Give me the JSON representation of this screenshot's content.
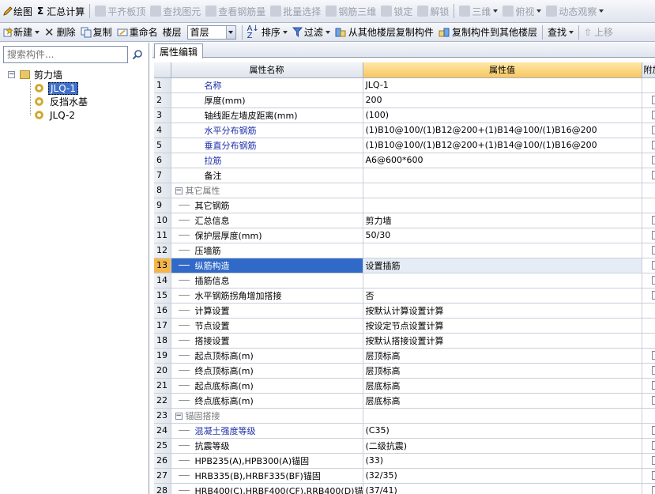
{
  "toolbar_main": {
    "draw": "绘图",
    "sum_calc": "汇总计算",
    "flush_slab": "平齐板顶",
    "find_element": "查找图元",
    "view_rebar": "查看钢筋量",
    "batch_select": "批量选择",
    "rebar_3d": "钢筋三维",
    "lock": "锁定",
    "unlock": "解锁",
    "three_d": "三维",
    "top_view": "俯视",
    "dynamic_view": "动态观察"
  },
  "toolbar_second": {
    "new": "新建",
    "delete": "删除",
    "copy": "复制",
    "rename": "重命名",
    "floor_label": "楼层",
    "floor_value": "首层",
    "sort": "排序",
    "filter": "过滤",
    "copy_from_floor": "从其他楼层复制构件",
    "copy_to_floor": "复制构件到其他楼层",
    "find": "查找",
    "up_move": "上移"
  },
  "left_panel": {
    "search_placeholder": "搜索构件...",
    "tree": {
      "root": "剪力墙",
      "children": [
        "JLQ-1",
        "反挡水基",
        "JLQ-2"
      ]
    }
  },
  "right_panel": {
    "tab": "属性编辑",
    "headers": {
      "name": "属性名称",
      "value": "属性值",
      "extra": "附加"
    },
    "rows": [
      {
        "n": "1",
        "name": "名称",
        "value": "JLQ-1",
        "style": "blue",
        "chk": false
      },
      {
        "n": "2",
        "name": "厚度(mm)",
        "value": "200",
        "style": "normal",
        "chk": true
      },
      {
        "n": "3",
        "name": "轴线距左墙皮距离(mm)",
        "value": "(100)",
        "style": "normal",
        "chk": true
      },
      {
        "n": "4",
        "name": "水平分布钢筋",
        "value": "(1)B10@100/(1)B12@200+(1)B14@100/(1)B16@200",
        "style": "blue",
        "chk": true
      },
      {
        "n": "5",
        "name": "垂直分布钢筋",
        "value": "(1)B10@100/(1)B12@200+(1)B14@100/(1)B16@200",
        "style": "blue",
        "chk": true
      },
      {
        "n": "6",
        "name": "拉筋",
        "value": "A6@600*600",
        "style": "blue",
        "chk": true
      },
      {
        "n": "7",
        "name": "备注",
        "value": "",
        "style": "normal",
        "chk": true
      },
      {
        "n": "8",
        "name": "其它属性",
        "value": "",
        "style": "group",
        "chk": false
      },
      {
        "n": "9",
        "name": "其它钢筋",
        "value": "",
        "style": "child",
        "chk": false
      },
      {
        "n": "10",
        "name": "汇总信息",
        "value": "剪力墙",
        "style": "child",
        "chk": true
      },
      {
        "n": "11",
        "name": "保护层厚度(mm)",
        "value": "50/30",
        "style": "child",
        "chk": true
      },
      {
        "n": "12",
        "name": "压墙筋",
        "value": "",
        "style": "child",
        "chk": true
      },
      {
        "n": "13",
        "name": "纵筋构造",
        "value": "设置插筋",
        "style": "child",
        "chk": true
      },
      {
        "n": "14",
        "name": "插筋信息",
        "value": "",
        "style": "child",
        "chk": true
      },
      {
        "n": "15",
        "name": "水平钢筋拐角增加搭接",
        "value": "否",
        "style": "child",
        "chk": true
      },
      {
        "n": "16",
        "name": "计算设置",
        "value": "按默认计算设置计算",
        "style": "child",
        "chk": false
      },
      {
        "n": "17",
        "name": "节点设置",
        "value": "按设定节点设置计算",
        "style": "child",
        "chk": false
      },
      {
        "n": "18",
        "name": "搭接设置",
        "value": "按默认搭接设置计算",
        "style": "child",
        "chk": false
      },
      {
        "n": "19",
        "name": "起点顶标高(m)",
        "value": "层顶标高",
        "style": "child",
        "chk": true
      },
      {
        "n": "20",
        "name": "终点顶标高(m)",
        "value": "层顶标高",
        "style": "child",
        "chk": true
      },
      {
        "n": "21",
        "name": "起点底标高(m)",
        "value": "层底标高",
        "style": "child",
        "chk": true
      },
      {
        "n": "22",
        "name": "终点底标高(m)",
        "value": "层底标高",
        "style": "child",
        "chk": true
      },
      {
        "n": "23",
        "name": "锚固搭接",
        "value": "",
        "style": "group",
        "chk": false
      },
      {
        "n": "24",
        "name": "混凝土强度等级",
        "value": "(C35)",
        "style": "childblue",
        "chk": true
      },
      {
        "n": "25",
        "name": "抗震等级",
        "value": "(二级抗震)",
        "style": "child",
        "chk": true
      },
      {
        "n": "26",
        "name": "HPB235(A),HPB300(A)锚固",
        "value": "(33)",
        "style": "child",
        "chk": true
      },
      {
        "n": "27",
        "name": "HRB335(B),HRBF335(BF)锚固",
        "value": "(32/35)",
        "style": "child",
        "chk": true
      },
      {
        "n": "28",
        "name": "HRB400(C),HRBF400(CF),RRB400(D)锚",
        "value": "(37/41)",
        "style": "child",
        "chk": true
      }
    ]
  }
}
